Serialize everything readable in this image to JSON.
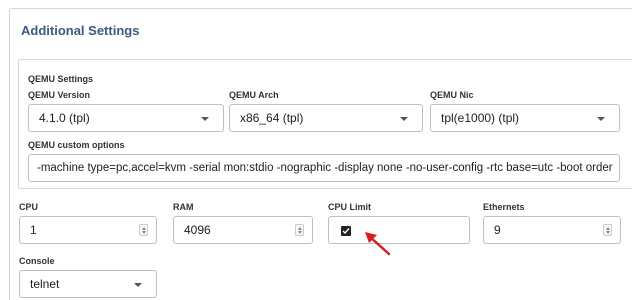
{
  "panel": {
    "title": "Additional Settings"
  },
  "qemu": {
    "section_label": "QEMU Settings",
    "version": {
      "label": "QEMU Version",
      "value": "4.1.0 (tpl)"
    },
    "arch": {
      "label": "QEMU Arch",
      "value": "x86_64 (tpl)"
    },
    "nic": {
      "label": "QEMU Nic",
      "value": "tpl(e1000) (tpl)"
    },
    "custom_options": {
      "label": "QEMU custom options",
      "value": "-machine type=pc,accel=kvm -serial mon:stdio -nographic -display none -no-user-config -rtc base=utc -boot order"
    }
  },
  "cpu": {
    "label": "CPU",
    "value": "1"
  },
  "ram": {
    "label": "RAM",
    "value": "4096"
  },
  "cpu_limit": {
    "label": "CPU Limit",
    "checked": true
  },
  "ethernets": {
    "label": "Ethernets",
    "value": "9"
  },
  "console": {
    "label": "Console",
    "value": "telnet"
  },
  "colors": {
    "title": "#3d5a80",
    "arrow": "#d62020",
    "border": "#b9c1c8"
  },
  "icons": {
    "select_caret": "chevron-down-icon",
    "spinner": "spinner-icon",
    "check": "check-icon",
    "annotation": "red-arrow-icon"
  }
}
